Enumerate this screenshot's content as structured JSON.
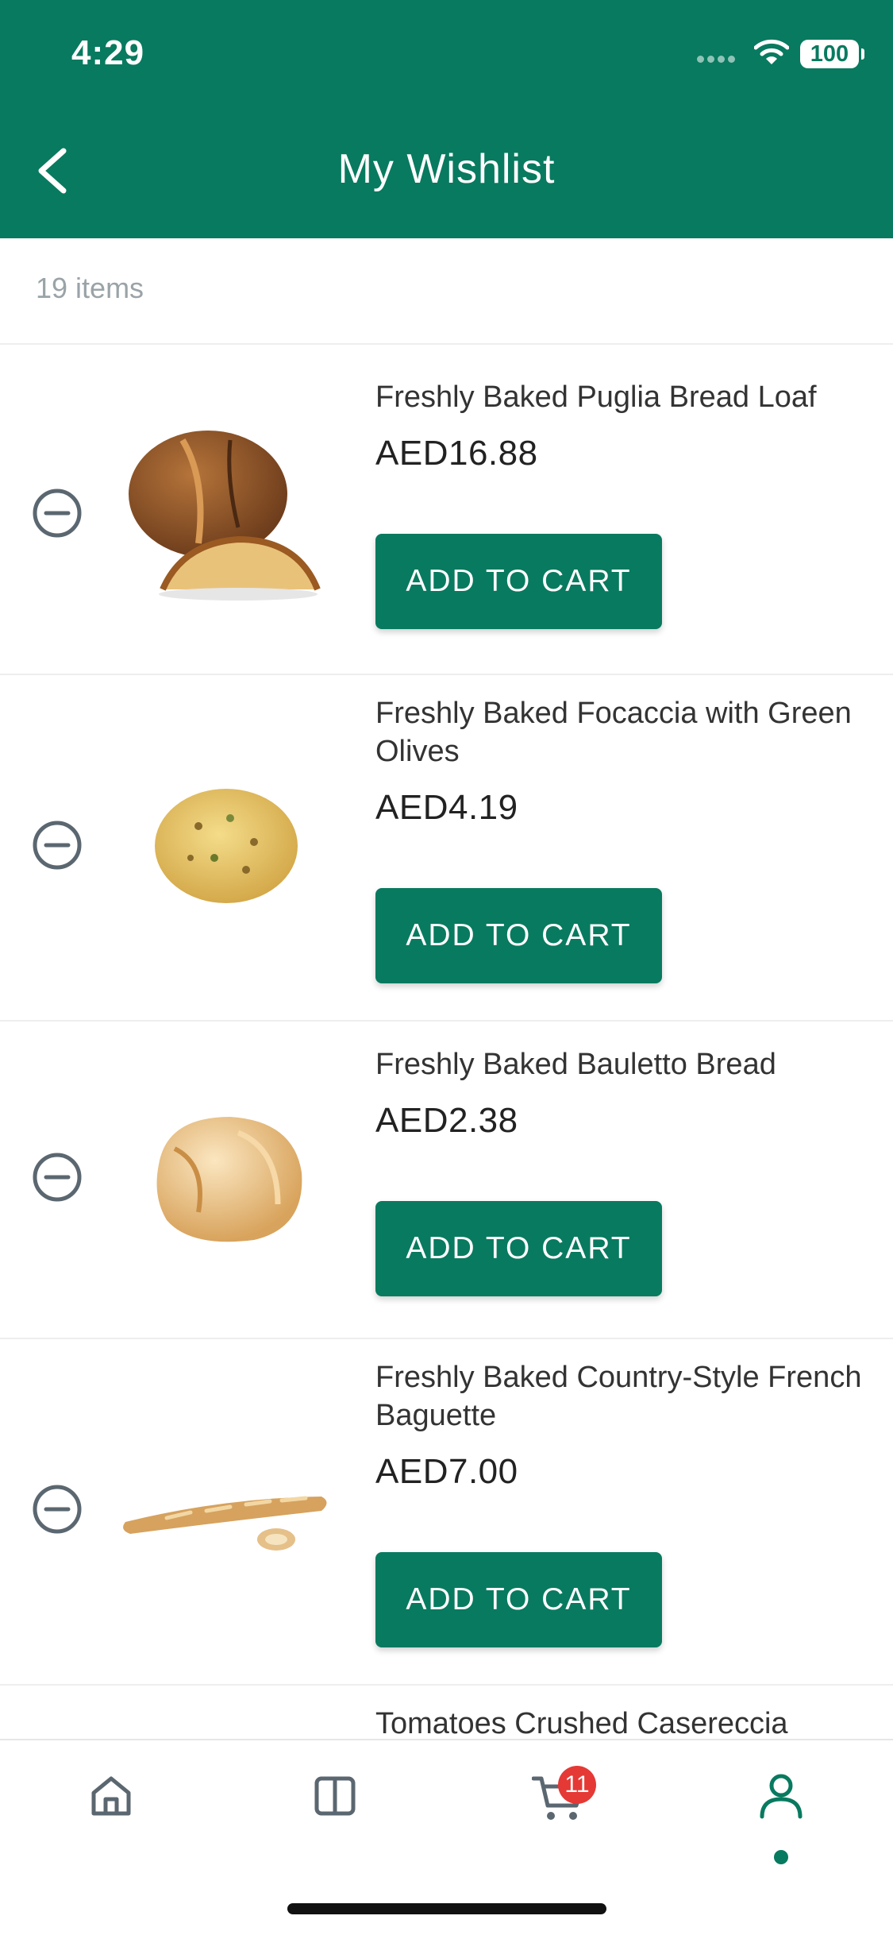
{
  "status_bar": {
    "time": "4:29",
    "battery": "100"
  },
  "header": {
    "title": "My Wishlist",
    "back_icon": "chevron-left-icon",
    "background": "#087a5f"
  },
  "wishlist": {
    "count_label": "19 items",
    "items": [
      {
        "name": "Freshly Baked Puglia Bread Loaf",
        "price": "AED16.88",
        "button_label": "ADD TO CART",
        "image": "puglia-bread-loaf"
      },
      {
        "name": "Freshly Baked Focaccia with Green Olives",
        "price": "AED4.19",
        "button_label": "ADD TO CART",
        "image": "focaccia-green-olives"
      },
      {
        "name": "Freshly Baked Bauletto Bread",
        "price": "AED2.38",
        "button_label": "ADD TO CART",
        "image": "bauletto-bread"
      },
      {
        "name": "Freshly Baked Country-Style French Baguette",
        "price": "AED7.00",
        "button_label": "ADD TO CART",
        "image": "french-baguette"
      },
      {
        "name": "Tomatoes Crushed Casereccia",
        "image": "tomatoes-crushed"
      }
    ]
  },
  "tabbar": {
    "tabs": [
      {
        "name": "home",
        "icon": "home-icon"
      },
      {
        "name": "categories",
        "icon": "columns-icon"
      },
      {
        "name": "cart",
        "icon": "cart-icon",
        "badge": "11"
      },
      {
        "name": "account",
        "icon": "user-icon",
        "active": true
      }
    ]
  },
  "colors": {
    "primary": "#087a5f",
    "badge": "#e53935",
    "muted_text": "#9aa3a8",
    "icon_gray": "#5b6770"
  }
}
